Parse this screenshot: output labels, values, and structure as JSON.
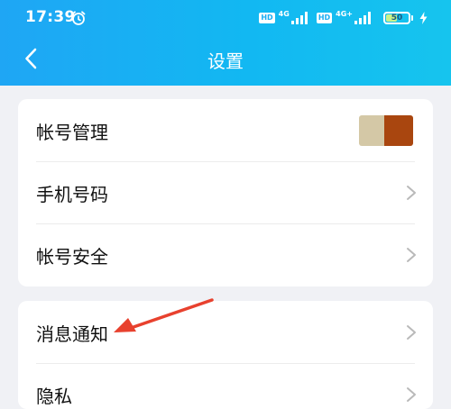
{
  "status": {
    "time": "17:39",
    "hd1": "HD",
    "net1": "4G",
    "hd2": "HD",
    "net2": "4G+",
    "battery_level": "50",
    "battery_fraction": 0.5
  },
  "nav": {
    "title": "设置",
    "back_icon": "chevron-left-icon"
  },
  "settings": {
    "group1": [
      {
        "label": "帐号管理",
        "trailing": "avatar"
      },
      {
        "label": "手机号码",
        "trailing": "chevron"
      },
      {
        "label": "帐号安全",
        "trailing": "chevron"
      }
    ],
    "group2": [
      {
        "label": "消息通知",
        "trailing": "chevron"
      },
      {
        "label": "隐私",
        "trailing": "chevron"
      }
    ]
  },
  "colors": {
    "header_gradient_start": "#1fa6f4",
    "header_gradient_end": "#16c4ee",
    "background": "#f0f1f5",
    "annotation_arrow": "#e8412e",
    "avatar_left": "#d4c8a6",
    "avatar_right": "#a9460f",
    "chevron": "#b9b9b9"
  }
}
